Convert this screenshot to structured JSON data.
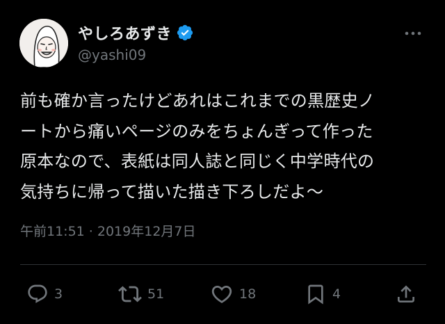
{
  "tweet": {
    "display_name": "やしろあずき",
    "handle": "@yashi09",
    "verified": true,
    "text_lines": [
      "前も確か言ったけどあれはこれまでの黒歴史ノ",
      "ートから痛いページのみをちょんぎって作った",
      "原本なので、表紙は同人誌と同じく中学時代の",
      "気持ちに帰って描いた描き下ろしだよ〜"
    ],
    "timestamp": "午前11:51 · 2019年12月7日"
  },
  "actions": {
    "replies": "3",
    "retweets": "51",
    "likes": "18",
    "bookmarks": "4"
  },
  "colors": {
    "background": "#000000",
    "text": "#e7e9ea",
    "muted": "#71767b",
    "verified": "#1d9bf0",
    "divider": "#2f3336"
  },
  "icons": {
    "more": "more-horizontal-icon",
    "verified": "verified-badge-icon",
    "reply": "reply-icon",
    "retweet": "retweet-icon",
    "like": "heart-icon",
    "bookmark": "bookmark-icon",
    "share": "share-icon"
  }
}
